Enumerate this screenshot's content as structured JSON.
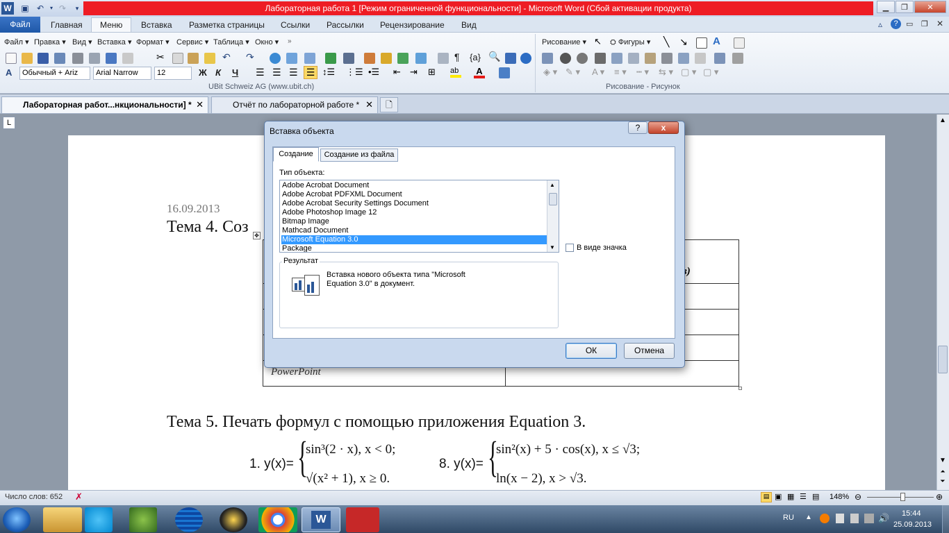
{
  "window": {
    "title": "Лабораторная работа 1 [Режим ограниченной функциональности]  -  Microsoft Word (Сбой активации продукта)"
  },
  "ribbon_tabs": [
    "Файл",
    "Главная",
    "Меню",
    "Вставка",
    "Разметка страницы",
    "Ссылки",
    "Рассылки",
    "Рецензирование",
    "Вид"
  ],
  "menu_bar": [
    "Файл",
    "Правка",
    "Вид",
    "Вставка",
    "Формат",
    "Сервис",
    "Таблица",
    "Окно"
  ],
  "toolbar": {
    "style_value": "Обычный + Ariz",
    "font_value": "Arial Narrow",
    "size_value": "12",
    "bold": "Ж",
    "italic": "К",
    "underline": "Ч",
    "credit": "UBit Schweiz AG    (www.ubit.ch)",
    "drawing_label": "Рисование",
    "shapes_label": "Фигуры",
    "drawing_group": "Рисование - Рисунок",
    "braces": "{a}",
    "pilcrow": "¶"
  },
  "doc_tabs": [
    {
      "label": "Лабораторная работ...нкциональности] *",
      "active": true
    },
    {
      "label": "Отчёт по лабораторной работе *",
      "active": false
    }
  ],
  "document": {
    "date": "16.09.2013",
    "heading4": "Тема 4. Соз",
    "table_header_frag": "в)",
    "table_cell_frag": "PowerPoint",
    "heading5": "Тема 5. Печать формул с помощью приложения Equation 3.",
    "eq1_label": "1. y(x)=",
    "eq1_line1": "sin³(2 · x), x < 0;",
    "eq1_line2": "√(x² + 1), x ≥ 0.",
    "eq8_label": "8. y(x)=",
    "eq8_line1": "sin²(x) + 5 · cos(x), x ≤ √3;",
    "eq8_line2": "ln(x − 2), x > √3."
  },
  "dialog": {
    "title": "Вставка объекта",
    "tab_create": "Создание",
    "tab_from_file": "Создание из файла",
    "object_type_label": "Тип объекта:",
    "object_types": [
      "Adobe Acrobat Document",
      "Adobe Acrobat PDFXML Document",
      "Adobe Acrobat Security Settings Document",
      "Adobe Photoshop Image 12",
      "Bitmap Image",
      "Mathcad Document",
      "Microsoft Equation 3.0",
      "Package"
    ],
    "selected_index": 6,
    "as_icon_label": "В виде значка",
    "result_label": "Результат",
    "result_text_1": "Вставка нового объекта типа \"Microsoft",
    "result_text_2": "Equation 3.0\" в документ.",
    "ok": "ОК",
    "cancel": "Отмена",
    "help": "?",
    "close": "x"
  },
  "statusbar": {
    "word_count": "Число слов: 652",
    "zoom": "148%"
  },
  "taskbar": {
    "lang": "RU",
    "time": "15:44",
    "date": "25.09.2013"
  },
  "colors": {
    "title_red": "#ee1c24",
    "selection_blue": "#3399ff",
    "file_tab_blue": "#2a66b8"
  }
}
